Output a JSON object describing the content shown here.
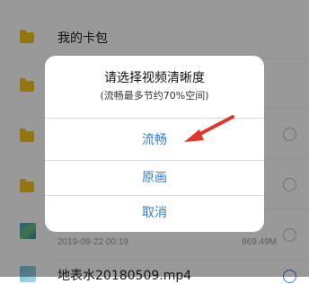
{
  "file_list": {
    "rows": [
      {
        "label": "我的卡包"
      }
    ],
    "video_item": {
      "date": "2019-09-22 00:19",
      "size": "869.49M"
    },
    "next_item_label": "地表水20180509.mp4"
  },
  "dialog": {
    "title": "请选择视频清晰度",
    "subtitle": "(流畅最多节约70%空间)",
    "options": [
      {
        "label": "流畅"
      },
      {
        "label": "原画"
      },
      {
        "label": "取消"
      }
    ]
  },
  "colors": {
    "accent": "#2f7dd1",
    "arrow": "#e0362c",
    "folder": "#f5c518"
  }
}
